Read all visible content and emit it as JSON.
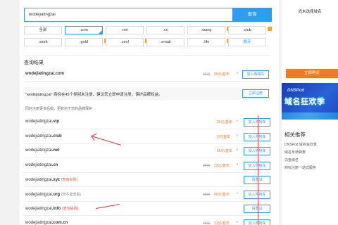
{
  "search": {
    "value": "wodejiatingzai",
    "button": "查询"
  },
  "extensions": [
    {
      "label": "全部"
    },
    {
      "label": ".com"
    },
    {
      "label": ".net"
    },
    {
      "label": ".cn"
    },
    {
      "label": ".wang"
    },
    {
      "label": ".club"
    },
    {
      "label": ".work"
    },
    {
      "label": ".gold"
    },
    {
      "label": ".cool"
    },
    {
      "label": ".email"
    },
    {
      "label": ".life"
    },
    {
      "label": "展开"
    }
  ],
  "results_title": "查询结果",
  "first_row": {
    "name": "wodejiatingzai.com",
    "old": "55元",
    "price": "55元/首年",
    "caret": "∨",
    "button": "加入购物车"
  },
  "notice": {
    "text": "\"wodejiatingzai\" 商标在45个类别未注册，建议您立即申请注册，保护品牌权益。",
    "button": "立即注册"
  },
  "tip": "同时注册更多后缀，更有利于您的品牌保护",
  "rows": [
    {
      "base": "wodejiatingzai",
      "ext": ".vip",
      "status": "",
      "old": "",
      "price": "25元/首年",
      "caret": "∨",
      "button": "加入购物车"
    },
    {
      "base": "wodejiatingzai",
      "ext": ".club",
      "status": "",
      "old": "",
      "price": "9元/首年",
      "caret": "∨",
      "button": "加入购物车"
    },
    {
      "base": "wodejiatingzai",
      "ext": ".net",
      "status": "",
      "old": "",
      "price": "65元/首年",
      "caret": "∨",
      "button": "加入购物车"
    },
    {
      "base": "wodejiatingzai",
      "ext": ".cn",
      "status": "",
      "old": "39元",
      "price": "29元/首年",
      "caret": "∨",
      "button": "加入购物车"
    },
    {
      "base": "wodejiatingzai",
      "ext": ".xyz",
      "status": "(查询失败)",
      "old": "",
      "price": "",
      "caret": "",
      "button": "请重试"
    },
    {
      "base": "wodejiatingzai",
      "ext": ".org",
      "status": "(暂不能查看)",
      "old": "99元",
      "price": "60元/首年",
      "caret": "∨",
      "button": "加入购物车"
    },
    {
      "base": "wodejiatingzai",
      "ext": ".info",
      "status": "(查询失败)",
      "old": "",
      "price": "",
      "caret": "",
      "button": "请重试"
    },
    {
      "base": "wodejiatingzai",
      "ext": ".com.cn",
      "status": "",
      "old": "48元",
      "price": "31元/首年",
      "caret": "∨",
      "button": "加入购物车"
    }
  ],
  "side": {
    "hint": "尚未选择域名",
    "buy": "立即购买",
    "banner_logo": "DNSPod",
    "banner_slogan": "域名狂欢季",
    "rec_title": "相关推荐",
    "rec_items": [
      "DNSPod 域名狂欢季",
      "域名专场特惠",
      "白金域名",
      "商标注册一站式服务"
    ]
  },
  "colors": {
    "accent": "#2e9cf0",
    "price": "#f07a2b",
    "error": "#e94b3c"
  }
}
